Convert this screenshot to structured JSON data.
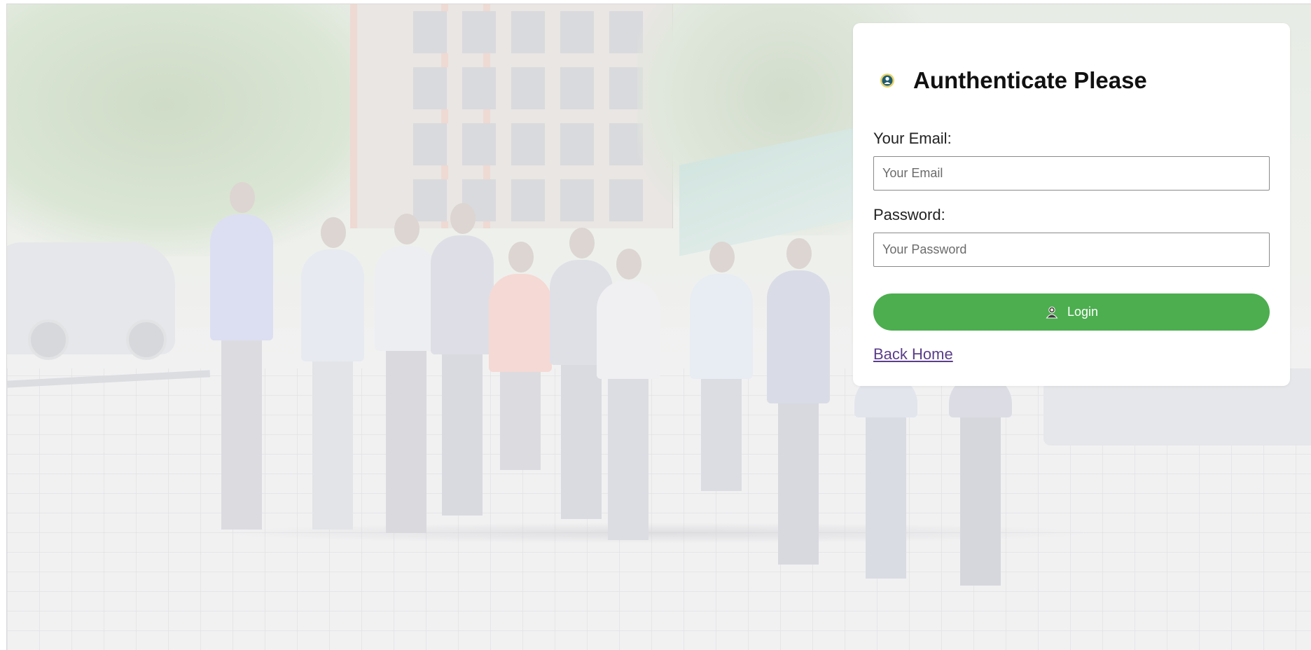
{
  "card": {
    "title": "Aunthenticate Please",
    "title_icon": "user-badge-icon",
    "email_label": "Your Email:",
    "email_placeholder": "Your Email",
    "email_value": "",
    "password_label": "Password:",
    "password_placeholder": "Your Password",
    "password_value": "",
    "login_label": "Login",
    "login_icon": "user-icon",
    "back_link": "Back Home"
  },
  "colors": {
    "accent_button": "#4cae4f",
    "link": "#5a3d8a",
    "card_bg": "#ffffff"
  },
  "background": {
    "description_icon": "group-photo-background"
  }
}
